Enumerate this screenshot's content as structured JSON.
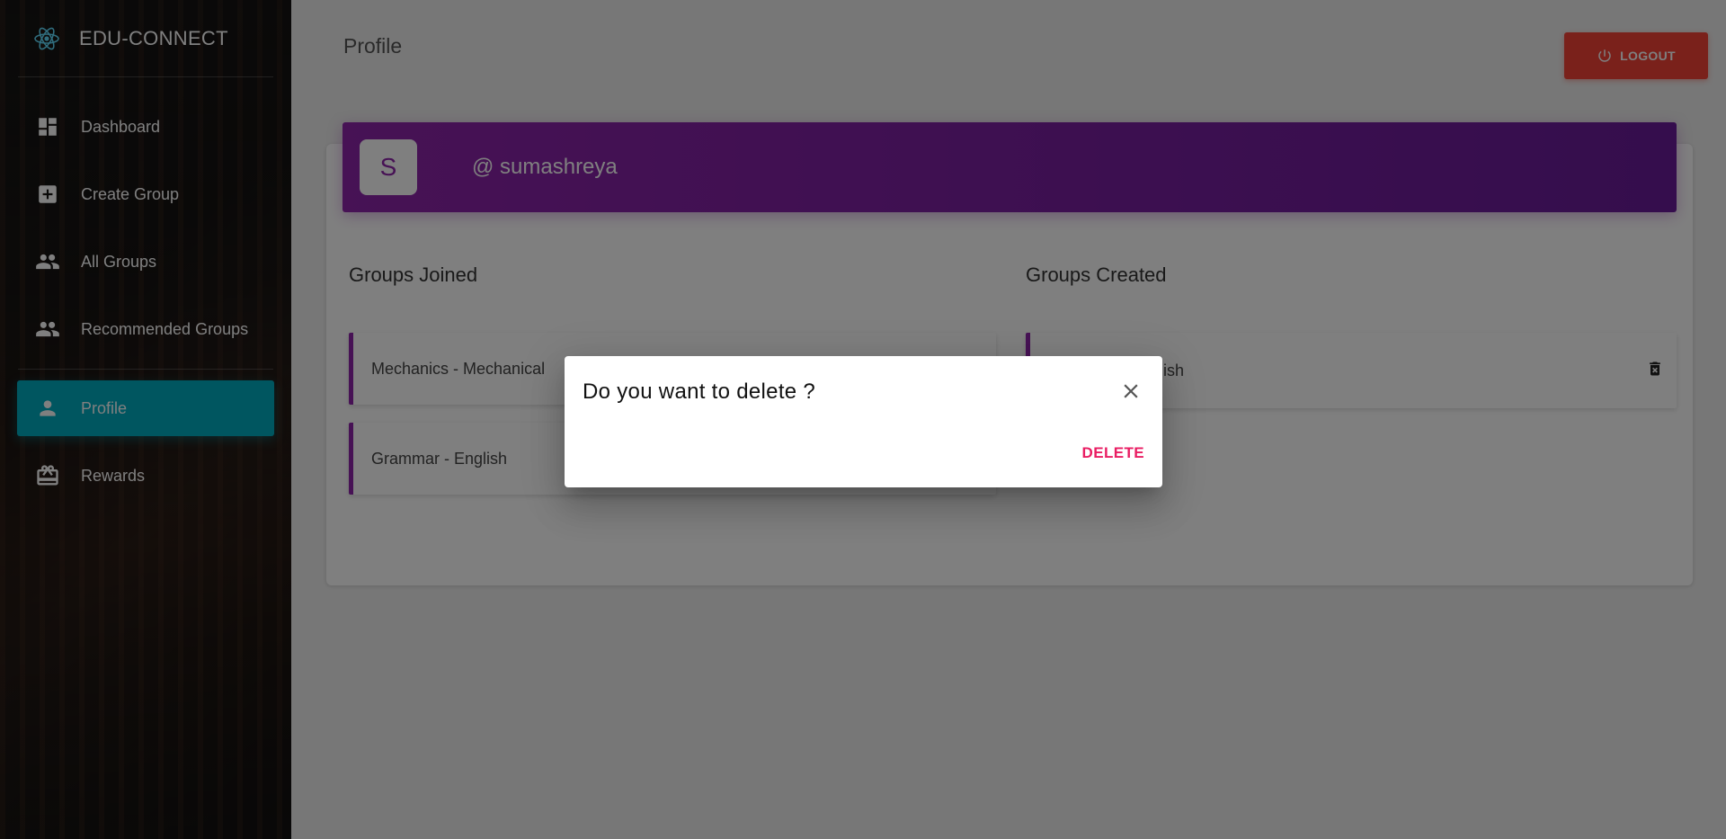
{
  "brand": {
    "title": "EDU-CONNECT",
    "logo_icon": "react-atom-icon"
  },
  "sidebar": {
    "items": [
      {
        "label": "Dashboard",
        "icon": "dashboard-icon"
      },
      {
        "label": "Create Group",
        "icon": "add-box-icon"
      },
      {
        "label": "All Groups",
        "icon": "people-icon"
      },
      {
        "label": "Recommended Groups",
        "icon": "people-icon"
      },
      {
        "label": "Profile",
        "icon": "person-icon",
        "active": true
      },
      {
        "label": "Rewards",
        "icon": "card-giftcard-icon"
      }
    ]
  },
  "header": {
    "page_title": "Profile",
    "logout_label": "LOGOUT"
  },
  "profile": {
    "avatar_letter": "S",
    "username": "@ sumashreya"
  },
  "groups_joined": {
    "title": "Groups Joined",
    "items": [
      "Mechanics - Mechanical",
      "Grammar - English"
    ]
  },
  "groups_created": {
    "title": "Groups Created",
    "items": [
      "Grammar - English"
    ]
  },
  "dialog": {
    "title": "Do you want to delete ?",
    "delete_label": "DELETE"
  },
  "colors": {
    "sidebar_active": "#00acc1",
    "profile_header": "#8e24aa",
    "logout": "#f44336",
    "delete_text": "#e91e63"
  }
}
